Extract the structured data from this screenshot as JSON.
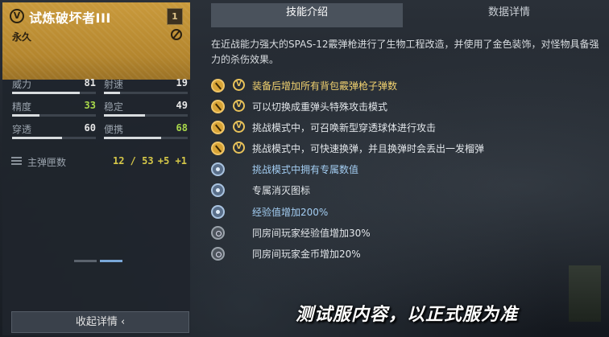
{
  "weapon": {
    "badge": "V",
    "name": "试炼破坏者III",
    "tier": "1",
    "duration": "永久"
  },
  "stats": [
    {
      "label": "威力",
      "value": "81",
      "level": 0.81,
      "highlight": false
    },
    {
      "label": "射速",
      "value": "19",
      "level": 0.19,
      "highlight": false
    },
    {
      "label": "精度",
      "value": "33",
      "level": 0.33,
      "highlight": true
    },
    {
      "label": "稳定",
      "value": "49",
      "level": 0.49,
      "highlight": false
    },
    {
      "label": "穿透",
      "value": "60",
      "level": 0.6,
      "highlight": false
    },
    {
      "label": "便携",
      "value": "68",
      "level": 0.68,
      "highlight": true
    }
  ],
  "magazine": {
    "label": "主弹匣数",
    "value": "12 / 53",
    "bonus": "+5 +1"
  },
  "collapse_button": "收起详情 ‹",
  "tabs": {
    "skills": "技能介绍",
    "data": "数据详情"
  },
  "description": "在近战能力强大的SPAS-12霰弹枪进行了生物工程改造，并使用了金色装饰，对怪物具备强力的杀伤效果。",
  "perks": [
    {
      "icon": "gold-ammo-icon",
      "tag": "V",
      "text": "装备后增加所有背包霰弹枪子弹数",
      "style": "gold"
    },
    {
      "icon": "gold-mode-icon",
      "tag": "V",
      "text": "可以切换成重弹头特殊攻击模式",
      "style": "white"
    },
    {
      "icon": "gold-sphere-icon",
      "tag": "V",
      "text": "挑战模式中，可召唤新型穿透球体进行攻击",
      "style": "white"
    },
    {
      "icon": "gold-grenade-icon",
      "tag": "V",
      "text": "挑战模式中，可快速换弹，并且换弹时会丢出一发榴弹",
      "style": "white"
    },
    {
      "icon": "blue-value-icon",
      "tag": "",
      "text": "挑战模式中拥有专属数值",
      "style": "blue"
    },
    {
      "icon": "blue-kill-icon",
      "tag": "",
      "text": "专属消灭图标",
      "style": "white"
    },
    {
      "icon": "exp-icon",
      "tag": "",
      "text": "经验值增加200%",
      "style": "blue"
    },
    {
      "icon": "room-exp-icon",
      "tag": "",
      "text": "同房间玩家经验值增加30%",
      "style": "white"
    },
    {
      "icon": "room-gold-icon",
      "tag": "",
      "text": "同房间玩家金币增加20%",
      "style": "white"
    }
  ],
  "watermark": "测试服内容，以正式服为准"
}
